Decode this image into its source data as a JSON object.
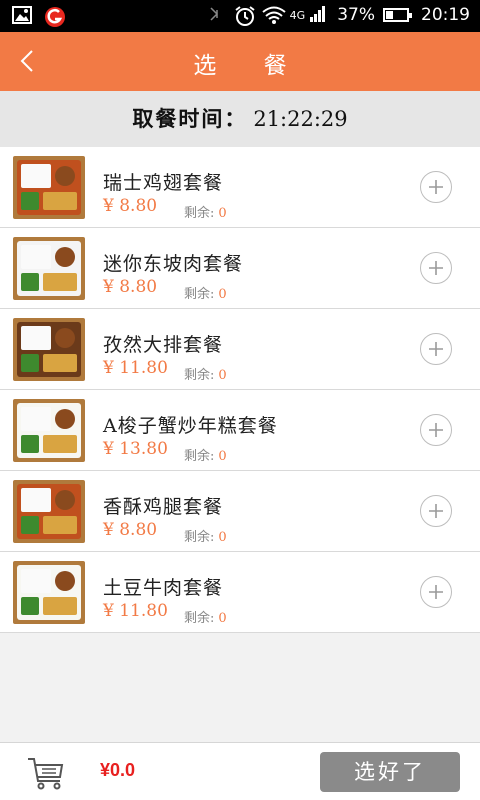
{
  "status_bar": {
    "signal_label": "4G",
    "battery": "37%",
    "battery_level": 0.37,
    "time": "20:19"
  },
  "header": {
    "title": "选 餐"
  },
  "pickup": {
    "label": "取餐时间：",
    "time": "21:22:29"
  },
  "meals": [
    {
      "name": "瑞士鸡翅套餐",
      "price": "¥ 8.80",
      "remain_label": "剩余:",
      "remain": "0",
      "thumb_style": "tray-orange"
    },
    {
      "name": "迷你东坡肉套餐",
      "price": "¥ 8.80",
      "remain_label": "剩余:",
      "remain": "0",
      "thumb_style": "tray-white"
    },
    {
      "name": "孜然大排套餐",
      "price": "¥ 11.80",
      "remain_label": "剩余:",
      "remain": "0",
      "thumb_style": "tray-brown"
    },
    {
      "name": "A梭子蟹炒年糕套餐",
      "price": "¥ 13.80",
      "remain_label": "剩余:",
      "remain": "0",
      "thumb_style": "box-white"
    },
    {
      "name": "香酥鸡腿套餐",
      "price": "¥ 8.80",
      "remain_label": "剩余:",
      "remain": "0",
      "thumb_style": "tray-orange"
    },
    {
      "name": "土豆牛肉套餐",
      "price": "¥ 11.80",
      "remain_label": "剩余:",
      "remain": "0",
      "thumb_style": "box-white"
    }
  ],
  "bottom": {
    "total": "¥0.0",
    "confirm_label": "选好了"
  },
  "colors": {
    "accent": "#f27a45",
    "price": "#f27a45",
    "total": "#e8201f",
    "confirm_bg": "#8a8a8a"
  },
  "icons": {
    "back": "chevron-left-icon",
    "add": "plus-circle-icon",
    "cart": "cart-icon"
  }
}
